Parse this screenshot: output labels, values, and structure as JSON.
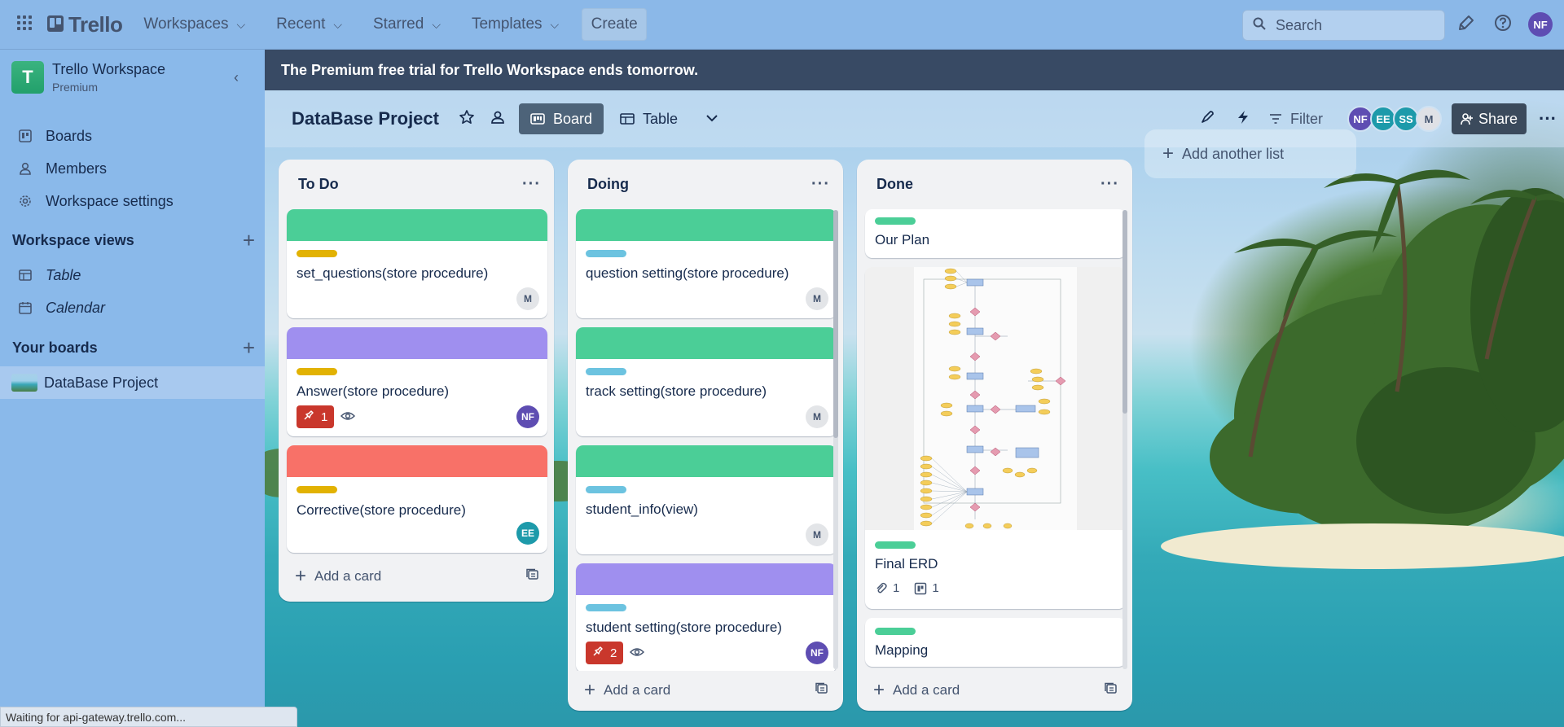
{
  "header": {
    "brand": "Trello",
    "nav": [
      {
        "label": "Workspaces"
      },
      {
        "label": "Recent"
      },
      {
        "label": "Starred"
      },
      {
        "label": "Templates"
      }
    ],
    "create_label": "Create",
    "search_placeholder": "Search",
    "user_initials": "NF"
  },
  "sidebar": {
    "workspace_initial": "T",
    "workspace_name": "Trello Workspace",
    "workspace_plan": "Premium",
    "items": [
      {
        "label": "Boards",
        "icon": "trello-board-icon"
      },
      {
        "label": "Members",
        "icon": "person-icon"
      },
      {
        "label": "Workspace settings",
        "icon": "gear-icon"
      }
    ],
    "views_title": "Workspace views",
    "views": [
      {
        "label": "Table",
        "icon": "table-icon"
      },
      {
        "label": "Calendar",
        "icon": "calendar-icon"
      }
    ],
    "boards_title": "Your boards",
    "boards": [
      {
        "label": "DataBase Project"
      }
    ]
  },
  "banner": "The Premium free trial for Trello Workspace ends tomorrow.",
  "board": {
    "title": "DataBase Project",
    "views": [
      {
        "label": "Board",
        "active": true
      },
      {
        "label": "Table",
        "active": false
      }
    ],
    "filter_label": "Filter",
    "members": [
      {
        "initials": "NF",
        "color": "#5e4db2"
      },
      {
        "initials": "EE",
        "color": "#1d9aaa"
      },
      {
        "initials": "SS",
        "color": "#1d9aaa"
      },
      {
        "initials": "M",
        "color": "#dfe1e6"
      }
    ],
    "share_label": "Share",
    "add_list_label": "Add another list"
  },
  "lists": [
    {
      "title": "To Do",
      "add_card": "Add a card",
      "cards": [
        {
          "title": "set_questions(store procedure)",
          "cover": "#4bce97",
          "label": "#e2b203",
          "member": "M"
        },
        {
          "title": "Answer(store procedure)",
          "cover": "#9f8fef",
          "label": "#e2b203",
          "member": "NF",
          "alerts": "1"
        },
        {
          "title": "Corrective(store procedure)",
          "cover": "#f87168",
          "label": "#e2b203",
          "member": "EE"
        }
      ]
    },
    {
      "title": "Doing",
      "add_card": "Add a card",
      "cards": [
        {
          "title": "question setting(store procedure)",
          "cover": "#4bce97",
          "label": "#6cc3e0",
          "member": "M"
        },
        {
          "title": "track setting(store procedure)",
          "cover": "#4bce97",
          "label": "#6cc3e0",
          "member": "M"
        },
        {
          "title": "student_info(view)",
          "cover": "#4bce97",
          "label": "#6cc3e0",
          "member": "M"
        },
        {
          "title": "student setting(store procedure)",
          "cover": "#9f8fef",
          "label": "#6cc3e0",
          "member": "NF",
          "alerts": "2"
        }
      ]
    },
    {
      "title": "Done",
      "add_card": "Add a card",
      "cards": [
        {
          "title": "Our Plan",
          "label": "#4bce97"
        },
        {
          "title": "Final ERD",
          "label": "#4bce97",
          "attachments": "1",
          "checklist": "1"
        },
        {
          "title": "Mapping",
          "label": "#4bce97"
        }
      ]
    }
  ],
  "status": "Waiting for api-gateway.trello.com..."
}
